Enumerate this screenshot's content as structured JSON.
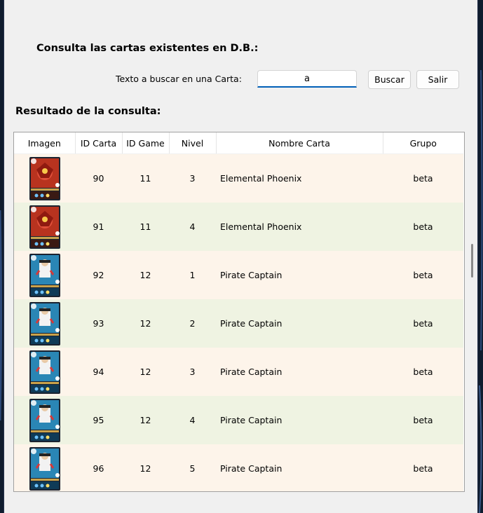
{
  "header": {
    "title": "Consulta las cartas existentes en D.B.:"
  },
  "search": {
    "label": "Texto a buscar en una Carta:",
    "value": "a",
    "search_button": "Buscar",
    "exit_button": "Salir"
  },
  "results": {
    "label": "Resultado de la consulta:",
    "columns": [
      "Imagen",
      "ID Carta",
      "ID Game",
      "Nivel",
      "Nombre Carta",
      "Grupo"
    ],
    "rows": [
      {
        "image_icon": "elemental-phoenix-card-icon",
        "id_carta": "90",
        "id_game": "11",
        "nivel": "3",
        "nombre": "Elemental Phoenix",
        "grupo": "beta"
      },
      {
        "image_icon": "elemental-phoenix-card-icon",
        "id_carta": "91",
        "id_game": "11",
        "nivel": "4",
        "nombre": "Elemental Phoenix",
        "grupo": "beta"
      },
      {
        "image_icon": "pirate-captain-card-icon",
        "id_carta": "92",
        "id_game": "12",
        "nivel": "1",
        "nombre": "Pirate Captain",
        "grupo": "beta"
      },
      {
        "image_icon": "pirate-captain-card-icon",
        "id_carta": "93",
        "id_game": "12",
        "nivel": "2",
        "nombre": "Pirate Captain",
        "grupo": "beta"
      },
      {
        "image_icon": "pirate-captain-card-icon",
        "id_carta": "94",
        "id_game": "12",
        "nivel": "3",
        "nombre": "Pirate Captain",
        "grupo": "beta"
      },
      {
        "image_icon": "pirate-captain-card-icon",
        "id_carta": "95",
        "id_game": "12",
        "nivel": "4",
        "nombre": "Pirate Captain",
        "grupo": "beta"
      },
      {
        "image_icon": "pirate-captain-card-icon",
        "id_carta": "96",
        "id_game": "12",
        "nivel": "5",
        "nombre": "Pirate Captain",
        "grupo": "beta"
      }
    ]
  },
  "colors": {
    "row_odd": "#fdf4ea",
    "row_even": "#eff3e2",
    "input_accent": "#005fb8",
    "phoenix_card": "#b8331f",
    "pirate_card": "#2a86b5"
  }
}
